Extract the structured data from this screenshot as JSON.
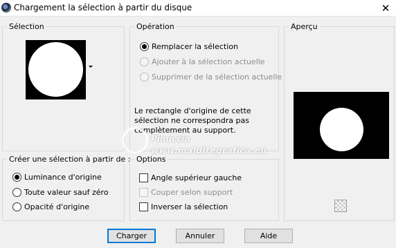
{
  "window": {
    "title": "Chargement la sélection à partir du disque",
    "close_glyph": "✕"
  },
  "selection_group": {
    "label": "Sélection"
  },
  "operation_group": {
    "label": "Opération",
    "options": [
      {
        "label": "Remplacer la sélection",
        "checked": true,
        "enabled": true
      },
      {
        "label": "Ajouter à la sélection actuelle",
        "checked": false,
        "enabled": false
      },
      {
        "label": "Supprimer de la sélection actuelle",
        "checked": false,
        "enabled": false
      }
    ],
    "info": "Le rectangle d'origine de cette sélection ne correspondra pas complètement au support."
  },
  "preview_group": {
    "label": "Aperçu"
  },
  "create_group": {
    "label": "Créer une sélection à partir de :",
    "options": [
      {
        "label": "Luminance d'origine",
        "checked": true
      },
      {
        "label": "Toute valeur sauf zéro",
        "checked": false
      },
      {
        "label": "Opacité d'origine",
        "checked": false
      }
    ]
  },
  "options_group": {
    "label": "Options",
    "items": [
      {
        "label": "Angle supérieur gauche",
        "checked": false,
        "enabled": true
      },
      {
        "label": "Couper selon support",
        "checked": false,
        "enabled": false
      },
      {
        "label": "Inverser la sélection",
        "checked": false,
        "enabled": true
      }
    ]
  },
  "watermark": {
    "name": "Pinuccia",
    "site": "www.maldiregrafica.eu"
  },
  "buttons": {
    "load": "Charger",
    "cancel": "Annuler",
    "help": "Aide"
  }
}
